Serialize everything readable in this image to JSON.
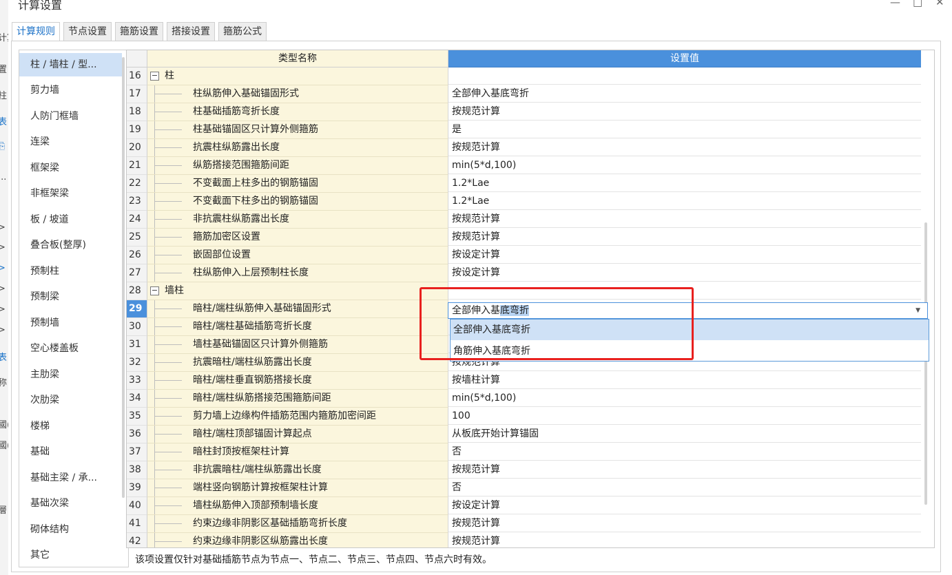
{
  "background_window": {
    "fragments": [
      "计算",
      "置",
      "柱",
      "表",
      "⎘",
      "...",
      ">",
      ">",
      ">",
      ">",
      ">",
      ">",
      "表",
      "称",
      "國(",
      "國(",
      "層"
    ]
  },
  "window": {
    "title": "计算设置",
    "minimize": "—",
    "restore": "□",
    "close": "✕"
  },
  "tabs": [
    "计算规则",
    "节点设置",
    "箍筋设置",
    "搭接设置",
    "箍筋公式"
  ],
  "nav": {
    "items": [
      "柱 / 墙柱 / 型...",
      "剪力墙",
      "人防门框墙",
      "连梁",
      "框架梁",
      "非框架梁",
      "板 / 坡道",
      "叠合板(整厚)",
      "预制柱",
      "预制梁",
      "预制墙",
      "空心楼盖板",
      "主肋梁",
      "次肋梁",
      "楼梯",
      "基础",
      "基础主梁 / 承...",
      "基础次梁",
      "砌体结构",
      "其它"
    ],
    "selected_index": 0
  },
  "grid": {
    "headers": {
      "name": "类型名称",
      "value": "设置值"
    },
    "rows": [
      {
        "no": "16",
        "name": "柱",
        "value": "",
        "group": true
      },
      {
        "no": "17",
        "name": "柱纵筋伸入基础锚固形式",
        "value": "全部伸入基底弯折"
      },
      {
        "no": "18",
        "name": "柱基础插筋弯折长度",
        "value": "按规范计算"
      },
      {
        "no": "19",
        "name": "柱基础锚固区只计算外侧箍筋",
        "value": "是"
      },
      {
        "no": "20",
        "name": "抗震柱纵筋露出长度",
        "value": "按规范计算"
      },
      {
        "no": "21",
        "name": "纵筋搭接范围箍筋间距",
        "value": "min(5*d,100)"
      },
      {
        "no": "22",
        "name": "不变截面上柱多出的钢筋锚固",
        "value": "1.2*Lae"
      },
      {
        "no": "23",
        "name": "不变截面下柱多出的钢筋锚固",
        "value": "1.2*Lae"
      },
      {
        "no": "24",
        "name": "非抗震柱纵筋露出长度",
        "value": "按规范计算"
      },
      {
        "no": "25",
        "name": "箍筋加密区设置",
        "value": "按规范计算"
      },
      {
        "no": "26",
        "name": "嵌固部位设置",
        "value": "按设定计算"
      },
      {
        "no": "27",
        "name": "柱纵筋伸入上层预制柱长度",
        "value": "按设定计算"
      },
      {
        "no": "28",
        "name": "墙柱",
        "value": "",
        "group": true
      },
      {
        "no": "29",
        "name": "暗柱/端柱纵筋伸入基础锚固形式",
        "value": "",
        "selected": true
      },
      {
        "no": "30",
        "name": "暗柱/端柱基础插筋弯折长度",
        "value": ""
      },
      {
        "no": "31",
        "name": "墙柱基础锚固区只计算外侧箍筋",
        "value": ""
      },
      {
        "no": "32",
        "name": "抗震暗柱/端柱纵筋露出长度",
        "value": "按规范计算"
      },
      {
        "no": "33",
        "name": "暗柱/端柱垂直钢筋搭接长度",
        "value": "按墙柱计算"
      },
      {
        "no": "34",
        "name": "暗柱/端柱纵筋搭接范围箍筋间距",
        "value": "min(5*d,100)"
      },
      {
        "no": "35",
        "name": "剪力墙上边缘构件插筋范围内箍筋加密间距",
        "value": "100"
      },
      {
        "no": "36",
        "name": "暗柱/端柱顶部锚固计算起点",
        "value": "从板底开始计算锚固"
      },
      {
        "no": "37",
        "name": "暗柱封顶按框架柱计算",
        "value": "否"
      },
      {
        "no": "38",
        "name": "非抗震暗柱/端柱纵筋露出长度",
        "value": "按规范计算"
      },
      {
        "no": "39",
        "name": "端柱竖向钢筋计算按框架柱计算",
        "value": "否"
      },
      {
        "no": "40",
        "name": "墙柱纵筋伸入顶部预制墙长度",
        "value": "按设定计算"
      },
      {
        "no": "41",
        "name": "约束边缘非阴影区基础插筋弯折长度",
        "value": "按规范计算"
      },
      {
        "no": "42",
        "name": "约束边缘非阴影区纵筋露出长度",
        "value": "按规范计算"
      }
    ]
  },
  "combo": {
    "text_plain": "全部伸入基",
    "text_selected": "底弯折",
    "arrow": "▼",
    "options": [
      "全部伸入基底弯折",
      "角筋伸入基底弯折"
    ],
    "selected_index": 0
  },
  "footer": {
    "note": "该项设置仅针对基础插筋节点为节点一、节点二、节点三、节点四、节点六时有效。"
  },
  "colors": {
    "header_value_bg": "#4a90dc",
    "name_col_bg": "#fbf6dd",
    "highlight_box": "#e8201e",
    "tab_active_text": "#1e73c8"
  }
}
